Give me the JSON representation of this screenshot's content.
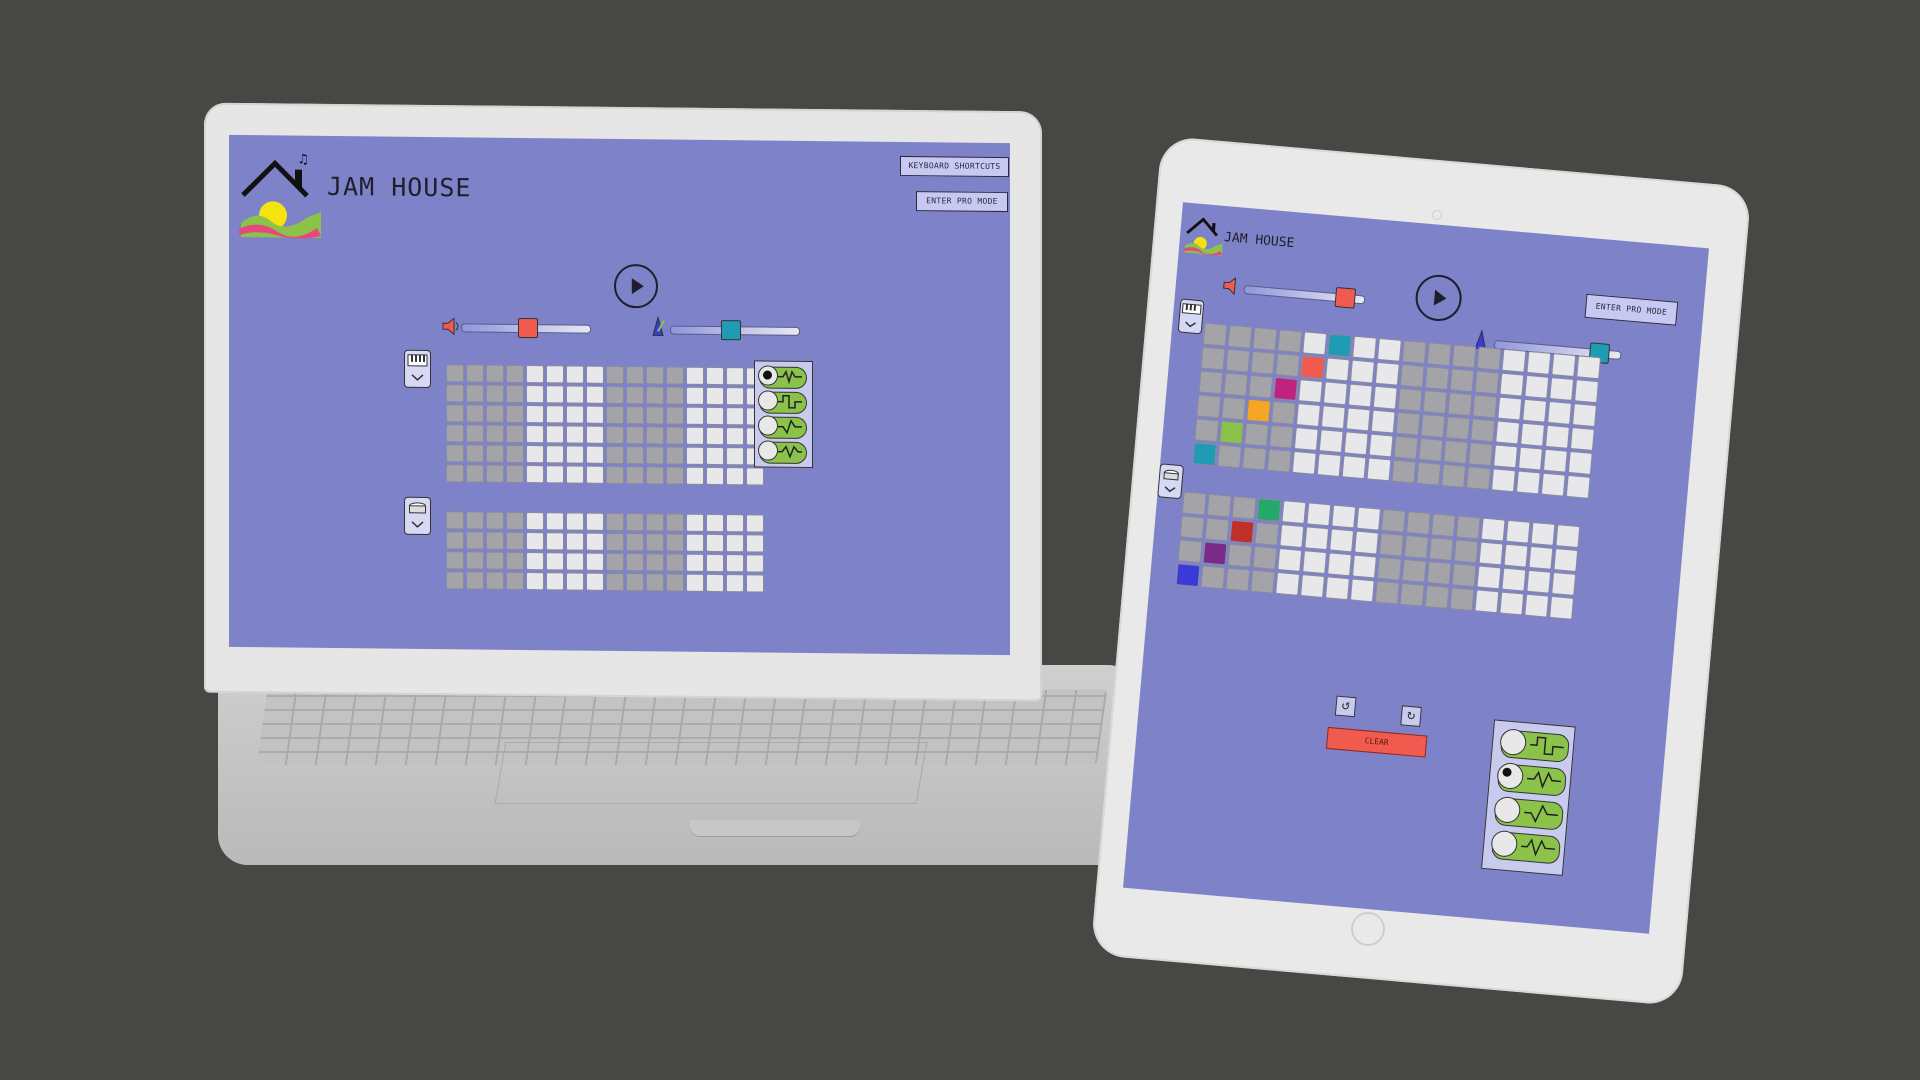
{
  "app": {
    "title": "JAM HOUSE"
  },
  "laptop": {
    "buttons": {
      "keyboard_shortcuts": "KEYBOARD SHORTCUTS",
      "pro_mode": "ENTER PRO MODE"
    },
    "volume_level": 0.52,
    "tempo_level": 0.45,
    "synth_selected_wave": 0
  },
  "tablet": {
    "buttons": {
      "pro_mode": "ENTER PRO MODE",
      "clear": "CLEAR"
    },
    "volume_level": 0.78,
    "tempo_level": 0.78,
    "synth_selected_wave": 1
  },
  "colors": {
    "screen_bg": "#7e83c9",
    "volume_thumb": "#f05a4f",
    "tempo_thumb": "#1f9bb4",
    "wave_green": "#8bc34a",
    "note_colors": [
      "#1f9bb4",
      "#f05a4f",
      "#c0227f",
      "#f5a623",
      "#8bc34a",
      "#1f9bb4",
      "#27a86b",
      "#c0302a",
      "#7b2a8a",
      "#3a3ad8"
    ]
  },
  "icons": [
    "house-logo-icon",
    "play-icon",
    "speaker-icon",
    "metronome-icon",
    "keyboard-icon",
    "drum-icon",
    "chevron-down-icon",
    "waveform-icon",
    "undo-icon",
    "redo-icon"
  ]
}
